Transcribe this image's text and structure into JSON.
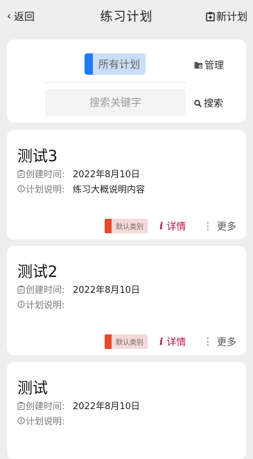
{
  "header": {
    "back_label": "返回",
    "title": "练习计划",
    "new_plan_label": "新计划"
  },
  "filter": {
    "category_label": "所有计划",
    "manage_label": "管理",
    "search_placeholder": "搜索关键字",
    "search_label": "搜索",
    "accent_color": "#1e7cf2"
  },
  "plans": [
    {
      "name": "测试3",
      "created_label": "创建时间:",
      "created_value": "2022年8月10日",
      "desc_label": "计划说明:",
      "desc_value": "练习大概说明内容",
      "type_tag": "默认类别",
      "detail_label": "详情",
      "more_label": "更多"
    },
    {
      "name": "测试2",
      "created_label": "创建时间:",
      "created_value": "2022年8月10日",
      "desc_label": "计划说明:",
      "desc_value": "",
      "type_tag": "默认类别",
      "detail_label": "详情",
      "more_label": "更多"
    },
    {
      "name": "测试",
      "created_label": "创建时间:",
      "created_value": "2022年8月10日",
      "desc_label": "计划说明:",
      "desc_value": ""
    }
  ],
  "icons": {
    "back": "chevron-left-icon",
    "new_plan": "clipboard-plus-icon",
    "manage": "folder-gear-icon",
    "search": "search-icon",
    "created": "calendar-clipboard-icon",
    "desc": "info-circle-icon",
    "detail": "info-i-icon",
    "more": "vertical-dots-icon"
  },
  "colors": {
    "tag_accent": "#e44a2e",
    "tag_bg": "#f6d8d8",
    "detail": "#b3164e"
  }
}
